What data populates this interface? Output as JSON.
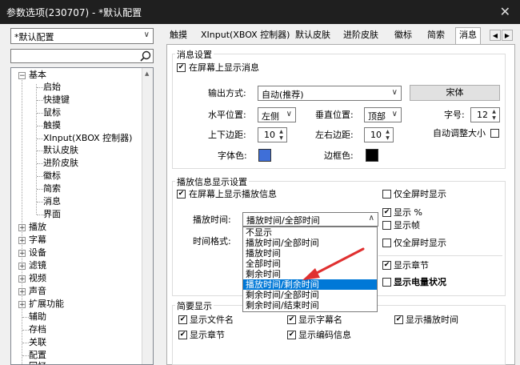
{
  "window": {
    "title": "参数选项(230707) - *默认配置",
    "close_glyph": "✕"
  },
  "preset": {
    "value": "*默认配置"
  },
  "search": {
    "value": ""
  },
  "tree": {
    "root": {
      "label": "基本",
      "children": [
        "启始",
        "快捷键",
        "鼠标",
        "触摸",
        "XInput(XBOX 控制器)",
        "默认皮肤",
        "进阶皮肤",
        "徽标",
        "简索",
        "消息",
        "界面"
      ]
    },
    "collapsed": [
      "播放",
      "字幕",
      "设备",
      "滤镜",
      "视频",
      "声音",
      "扩展功能"
    ],
    "plain": [
      "辅助",
      "存档",
      "关联",
      "配置",
      "回忆"
    ]
  },
  "tabs": [
    "触摸",
    "XInput(XBOX 控制器)",
    "默认皮肤",
    "进阶皮肤",
    "徽标",
    "简索",
    "消息"
  ],
  "msg_settings": {
    "group_title": "消息设置",
    "show_on_screen": "在屏幕上显示消息",
    "output_label": "输出方式:",
    "output_value": "自动(推荐)",
    "font_button": "宋体",
    "hpos_label": "水平位置:",
    "hpos_value": "左侧",
    "vpos_label": "垂直位置:",
    "vpos_value": "顶部",
    "size_label": "字号:",
    "size_value": "12",
    "tb_margin_label": "上下边距:",
    "tb_margin_value": "10",
    "lr_margin_label": "左右边距:",
    "lr_margin_value": "10",
    "auto_size_label": "自动调整大小",
    "font_color_label": "字体色:",
    "border_color_label": "边框色:",
    "font_color": "#3f6fd8",
    "border_color": "#000000"
  },
  "play_info": {
    "group_title": "播放信息显示设置",
    "show_play_info": "在屏幕上显示播放信息",
    "fullscreen_only": "仅全屏时显示",
    "play_time_label": "播放时间:",
    "play_time_value": "播放时间/全部时间",
    "time_format_label": "时间格式:",
    "show_percent": "显示 %",
    "show_frame": "显示帧",
    "fullscreen_only2": "仅全屏时显示",
    "show_chapter": "显示章节",
    "show_battery": "显示电量状况",
    "dropdown_options": [
      "不显示",
      "播放时间/全部时间",
      "播放时间",
      "全部时间",
      "剩余时间",
      "播放时间/剩余时间",
      "剩余时间/全部时间",
      "剩余时间/结束时间"
    ]
  },
  "brief": {
    "group_title": "简要显示",
    "items": [
      "显示文件名",
      "显示字幕名",
      "显示播放时间",
      "显示章节",
      "显示编码信息"
    ]
  },
  "colors": {
    "selection": "#0078d7",
    "arrow": "#e03030"
  }
}
